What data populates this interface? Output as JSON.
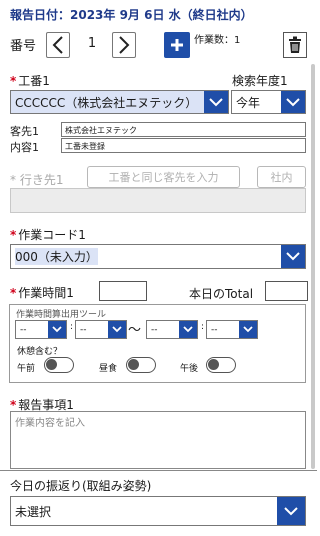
{
  "header": {
    "title": "報告日付：2023年 9月 6日 水（終日社内）",
    "number_label": "番号",
    "number_value": "1",
    "work_count": "作業数：1"
  },
  "koban": {
    "label": "工番1",
    "value": "CCCCCC（株式会社エヌテック）",
    "search_year_label": "検索年度1",
    "search_year_value": "今年"
  },
  "client": {
    "client_label": "客先1",
    "client_value": "株式会社エヌテック",
    "content_label": "内容1",
    "content_value": "工番未登録"
  },
  "destination": {
    "label": "行き先1",
    "same_client_button": "工番と同じ客先を入力",
    "inhouse_button": "社内"
  },
  "work_code": {
    "label": "作業コード1",
    "value": "000（未入力）"
  },
  "work_time": {
    "label": "作業時間1",
    "total_label": "本日のTotal"
  },
  "time_tool": {
    "title": "作業時間算出用ツール",
    "start_hour": "--",
    "start_min": "--",
    "tilde": "～",
    "end_hour": "--",
    "end_min": "--",
    "break_label": "休憩含む？",
    "am_label": "午前",
    "lunch_label": "昼食",
    "pm_label": "午後"
  },
  "report": {
    "label": "報告事項1",
    "placeholder": "作業内容を記入"
  },
  "reflection": {
    "label": "今日の振返り(取組み姿勢)",
    "value": "未選択"
  },
  "colors": {
    "accent": "#1f4ea8",
    "title": "#1f3a8a",
    "required": "#d0021b"
  }
}
